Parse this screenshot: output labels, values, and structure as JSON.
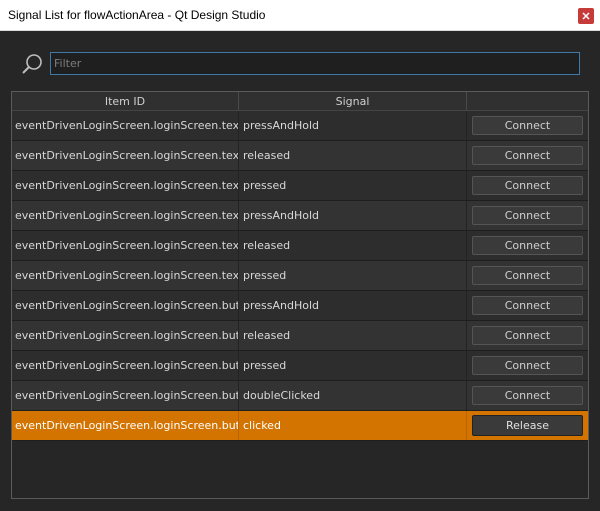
{
  "window": {
    "title": "Signal List for flowActionArea - Qt Design Studio"
  },
  "search": {
    "placeholder": "Filter",
    "value": ""
  },
  "table": {
    "headers": {
      "item_id": "Item ID",
      "signal": "Signal",
      "action": ""
    },
    "rows": [
      {
        "item_id": "eventDrivenLoginScreen.loginScreen.textFiel...",
        "signal": "pressAndHold",
        "action": "Connect",
        "selected": false
      },
      {
        "item_id": "eventDrivenLoginScreen.loginScreen.textFiel...",
        "signal": "released",
        "action": "Connect",
        "selected": false
      },
      {
        "item_id": "eventDrivenLoginScreen.loginScreen.textFiel...",
        "signal": "pressed",
        "action": "Connect",
        "selected": false
      },
      {
        "item_id": "eventDrivenLoginScreen.loginScreen.textField",
        "signal": "pressAndHold",
        "action": "Connect",
        "selected": false
      },
      {
        "item_id": "eventDrivenLoginScreen.loginScreen.textField",
        "signal": "released",
        "action": "Connect",
        "selected": false
      },
      {
        "item_id": "eventDrivenLoginScreen.loginScreen.textField",
        "signal": "pressed",
        "action": "Connect",
        "selected": false
      },
      {
        "item_id": "eventDrivenLoginScreen.loginScreen.button",
        "signal": "pressAndHold",
        "action": "Connect",
        "selected": false
      },
      {
        "item_id": "eventDrivenLoginScreen.loginScreen.button",
        "signal": "released",
        "action": "Connect",
        "selected": false
      },
      {
        "item_id": "eventDrivenLoginScreen.loginScreen.button",
        "signal": "pressed",
        "action": "Connect",
        "selected": false
      },
      {
        "item_id": "eventDrivenLoginScreen.loginScreen.button",
        "signal": "doubleClicked",
        "action": "Connect",
        "selected": false
      },
      {
        "item_id": "eventDrivenLoginScreen.loginScreen.button",
        "signal": "clicked",
        "action": "Release",
        "selected": true
      }
    ]
  },
  "colors": {
    "selection": "#d47400",
    "close_button": "#c63a3a",
    "filter_border": "#3f79a8"
  },
  "icons": {
    "search": "search-icon",
    "close": "close-icon"
  }
}
